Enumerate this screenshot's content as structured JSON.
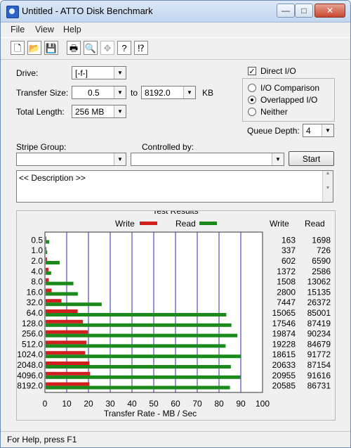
{
  "window": {
    "title": "Untitled - ATTO Disk Benchmark",
    "minimize": "—",
    "maximize": "□",
    "close": "✕"
  },
  "menu": [
    "File",
    "View",
    "Help"
  ],
  "toolbar": [
    {
      "name": "new-file-icon",
      "glyph": "🗋",
      "enabled": true
    },
    {
      "name": "open-folder-icon",
      "glyph": "📂",
      "enabled": true
    },
    {
      "name": "save-icon",
      "glyph": "💾",
      "enabled": true
    },
    {
      "name": "print-icon",
      "glyph": "🖶",
      "enabled": true
    },
    {
      "name": "print-preview-icon",
      "glyph": "🔍",
      "enabled": true
    },
    {
      "name": "move-icon",
      "glyph": "✥",
      "enabled": false
    },
    {
      "name": "help-icon",
      "glyph": "?",
      "enabled": true
    },
    {
      "name": "context-help-icon",
      "glyph": "⁉",
      "enabled": true
    }
  ],
  "settings": {
    "drive_label": "Drive:",
    "drive_value": "[-f-]",
    "transfer_size_label": "Transfer Size:",
    "transfer_from": "0.5",
    "to_label": "to",
    "transfer_to": "8192.0",
    "kb_label": "KB",
    "total_length_label": "Total Length:",
    "total_length_value": "256 MB",
    "direct_io_label": "Direct I/O",
    "direct_io_checked": true,
    "io_comparison_label": "I/O Comparison",
    "overlapped_io_label": "Overlapped I/O",
    "neither_label": "Neither",
    "selected_mode": "Overlapped I/O",
    "queue_depth_label": "Queue Depth:",
    "queue_depth_value": "4",
    "stripe_group_label": "Stripe Group:",
    "stripe_group_value": "",
    "controlled_by_label": "Controlled by:",
    "controlled_by_value": "",
    "start_label": "Start",
    "description_text": "<< Description >>"
  },
  "results": {
    "title": "Test Results",
    "legend_write": "Write",
    "legend_read": "Read",
    "col_write": "Write",
    "col_read": "Read",
    "write_color": "#d21e1e",
    "read_color": "#1b8a1b"
  },
  "chart_data": {
    "type": "bar",
    "orientation": "horizontal",
    "xlabel": "Transfer Rate - MB / Sec",
    "xlim": [
      0,
      100
    ],
    "xticks": [
      0,
      10,
      20,
      30,
      40,
      50,
      60,
      70,
      80,
      90,
      100
    ],
    "categories": [
      "0.5",
      "1.0",
      "2.0",
      "4.0",
      "8.0",
      "16.0",
      "32.0",
      "64.0",
      "128.0",
      "256.0",
      "512.0",
      "1024.0",
      "2048.0",
      "4096.0",
      "8192.0"
    ],
    "series": [
      {
        "name": "Write",
        "values": [
          0.16,
          0.33,
          0.59,
          1.34,
          1.47,
          2.73,
          7.27,
          14.71,
          17.14,
          19.41,
          18.78,
          18.18,
          20.15,
          20.46,
          20.1
        ]
      },
      {
        "name": "Read",
        "values": [
          1.66,
          0.71,
          6.44,
          2.53,
          12.76,
          14.78,
          25.75,
          83.01,
          85.37,
          88.12,
          82.69,
          89.62,
          85.11,
          89.47,
          84.7
        ]
      }
    ],
    "write_kbs": [
      "163",
      "337",
      "602",
      "1372",
      "1508",
      "2800",
      "7447",
      "15065",
      "17546",
      "19874",
      "19228",
      "18615",
      "20633",
      "20955",
      "20585"
    ],
    "read_kbs": [
      "1698",
      "726",
      "6590",
      "2586",
      "13062",
      "15135",
      "26372",
      "85001",
      "87419",
      "90234",
      "84679",
      "91772",
      "87154",
      "91616",
      "86731"
    ]
  },
  "status": {
    "text": "For Help, press F1"
  }
}
